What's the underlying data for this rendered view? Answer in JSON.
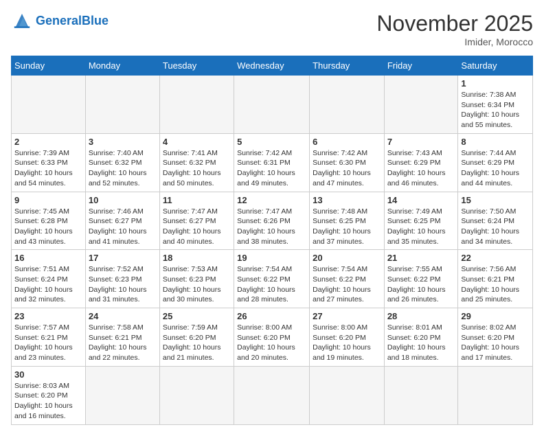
{
  "header": {
    "logo_general": "General",
    "logo_blue": "Blue",
    "month_title": "November 2025",
    "location": "Imider, Morocco"
  },
  "weekdays": [
    "Sunday",
    "Monday",
    "Tuesday",
    "Wednesday",
    "Thursday",
    "Friday",
    "Saturday"
  ],
  "days": [
    {
      "num": "",
      "sunrise": "",
      "sunset": "",
      "daylight": "",
      "empty": true
    },
    {
      "num": "",
      "sunrise": "",
      "sunset": "",
      "daylight": "",
      "empty": true
    },
    {
      "num": "",
      "sunrise": "",
      "sunset": "",
      "daylight": "",
      "empty": true
    },
    {
      "num": "",
      "sunrise": "",
      "sunset": "",
      "daylight": "",
      "empty": true
    },
    {
      "num": "",
      "sunrise": "",
      "sunset": "",
      "daylight": "",
      "empty": true
    },
    {
      "num": "",
      "sunrise": "",
      "sunset": "",
      "daylight": "",
      "empty": true
    },
    {
      "num": "1",
      "sunrise": "Sunrise: 7:38 AM",
      "sunset": "Sunset: 6:34 PM",
      "daylight": "Daylight: 10 hours and 55 minutes."
    },
    {
      "num": "2",
      "sunrise": "Sunrise: 7:39 AM",
      "sunset": "Sunset: 6:33 PM",
      "daylight": "Daylight: 10 hours and 54 minutes."
    },
    {
      "num": "3",
      "sunrise": "Sunrise: 7:40 AM",
      "sunset": "Sunset: 6:32 PM",
      "daylight": "Daylight: 10 hours and 52 minutes."
    },
    {
      "num": "4",
      "sunrise": "Sunrise: 7:41 AM",
      "sunset": "Sunset: 6:32 PM",
      "daylight": "Daylight: 10 hours and 50 minutes."
    },
    {
      "num": "5",
      "sunrise": "Sunrise: 7:42 AM",
      "sunset": "Sunset: 6:31 PM",
      "daylight": "Daylight: 10 hours and 49 minutes."
    },
    {
      "num": "6",
      "sunrise": "Sunrise: 7:42 AM",
      "sunset": "Sunset: 6:30 PM",
      "daylight": "Daylight: 10 hours and 47 minutes."
    },
    {
      "num": "7",
      "sunrise": "Sunrise: 7:43 AM",
      "sunset": "Sunset: 6:29 PM",
      "daylight": "Daylight: 10 hours and 46 minutes."
    },
    {
      "num": "8",
      "sunrise": "Sunrise: 7:44 AM",
      "sunset": "Sunset: 6:29 PM",
      "daylight": "Daylight: 10 hours and 44 minutes."
    },
    {
      "num": "9",
      "sunrise": "Sunrise: 7:45 AM",
      "sunset": "Sunset: 6:28 PM",
      "daylight": "Daylight: 10 hours and 43 minutes."
    },
    {
      "num": "10",
      "sunrise": "Sunrise: 7:46 AM",
      "sunset": "Sunset: 6:27 PM",
      "daylight": "Daylight: 10 hours and 41 minutes."
    },
    {
      "num": "11",
      "sunrise": "Sunrise: 7:47 AM",
      "sunset": "Sunset: 6:27 PM",
      "daylight": "Daylight: 10 hours and 40 minutes."
    },
    {
      "num": "12",
      "sunrise": "Sunrise: 7:47 AM",
      "sunset": "Sunset: 6:26 PM",
      "daylight": "Daylight: 10 hours and 38 minutes."
    },
    {
      "num": "13",
      "sunrise": "Sunrise: 7:48 AM",
      "sunset": "Sunset: 6:25 PM",
      "daylight": "Daylight: 10 hours and 37 minutes."
    },
    {
      "num": "14",
      "sunrise": "Sunrise: 7:49 AM",
      "sunset": "Sunset: 6:25 PM",
      "daylight": "Daylight: 10 hours and 35 minutes."
    },
    {
      "num": "15",
      "sunrise": "Sunrise: 7:50 AM",
      "sunset": "Sunset: 6:24 PM",
      "daylight": "Daylight: 10 hours and 34 minutes."
    },
    {
      "num": "16",
      "sunrise": "Sunrise: 7:51 AM",
      "sunset": "Sunset: 6:24 PM",
      "daylight": "Daylight: 10 hours and 32 minutes."
    },
    {
      "num": "17",
      "sunrise": "Sunrise: 7:52 AM",
      "sunset": "Sunset: 6:23 PM",
      "daylight": "Daylight: 10 hours and 31 minutes."
    },
    {
      "num": "18",
      "sunrise": "Sunrise: 7:53 AM",
      "sunset": "Sunset: 6:23 PM",
      "daylight": "Daylight: 10 hours and 30 minutes."
    },
    {
      "num": "19",
      "sunrise": "Sunrise: 7:54 AM",
      "sunset": "Sunset: 6:22 PM",
      "daylight": "Daylight: 10 hours and 28 minutes."
    },
    {
      "num": "20",
      "sunrise": "Sunrise: 7:54 AM",
      "sunset": "Sunset: 6:22 PM",
      "daylight": "Daylight: 10 hours and 27 minutes."
    },
    {
      "num": "21",
      "sunrise": "Sunrise: 7:55 AM",
      "sunset": "Sunset: 6:22 PM",
      "daylight": "Daylight: 10 hours and 26 minutes."
    },
    {
      "num": "22",
      "sunrise": "Sunrise: 7:56 AM",
      "sunset": "Sunset: 6:21 PM",
      "daylight": "Daylight: 10 hours and 25 minutes."
    },
    {
      "num": "23",
      "sunrise": "Sunrise: 7:57 AM",
      "sunset": "Sunset: 6:21 PM",
      "daylight": "Daylight: 10 hours and 23 minutes."
    },
    {
      "num": "24",
      "sunrise": "Sunrise: 7:58 AM",
      "sunset": "Sunset: 6:21 PM",
      "daylight": "Daylight: 10 hours and 22 minutes."
    },
    {
      "num": "25",
      "sunrise": "Sunrise: 7:59 AM",
      "sunset": "Sunset: 6:20 PM",
      "daylight": "Daylight: 10 hours and 21 minutes."
    },
    {
      "num": "26",
      "sunrise": "Sunrise: 8:00 AM",
      "sunset": "Sunset: 6:20 PM",
      "daylight": "Daylight: 10 hours and 20 minutes."
    },
    {
      "num": "27",
      "sunrise": "Sunrise: 8:00 AM",
      "sunset": "Sunset: 6:20 PM",
      "daylight": "Daylight: 10 hours and 19 minutes."
    },
    {
      "num": "28",
      "sunrise": "Sunrise: 8:01 AM",
      "sunset": "Sunset: 6:20 PM",
      "daylight": "Daylight: 10 hours and 18 minutes."
    },
    {
      "num": "29",
      "sunrise": "Sunrise: 8:02 AM",
      "sunset": "Sunset: 6:20 PM",
      "daylight": "Daylight: 10 hours and 17 minutes."
    },
    {
      "num": "30",
      "sunrise": "Sunrise: 8:03 AM",
      "sunset": "Sunset: 6:20 PM",
      "daylight": "Daylight: 10 hours and 16 minutes."
    }
  ]
}
